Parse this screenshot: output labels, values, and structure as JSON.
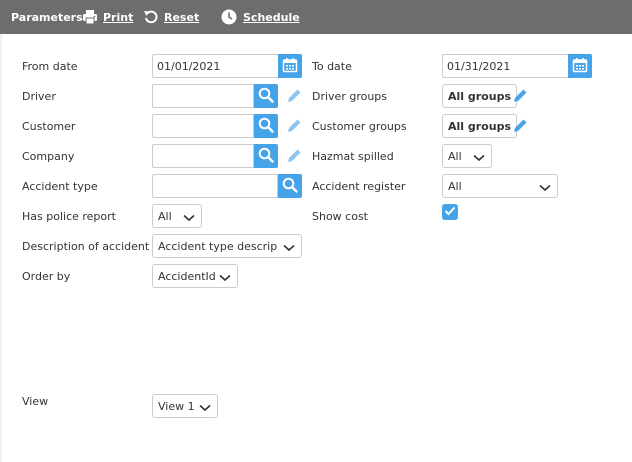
{
  "toolbar": {
    "title": "Parameters",
    "print_label": "Print",
    "reset_label": "Reset",
    "schedule_label": "Schedule"
  },
  "fields": {
    "from_date": {
      "label": "From date",
      "value": "01/01/2021"
    },
    "to_date": {
      "label": "To date",
      "value": "01/31/2021"
    },
    "driver": {
      "label": "Driver",
      "value": ""
    },
    "driver_groups": {
      "label": "Driver groups",
      "value": "All groups"
    },
    "customer": {
      "label": "Customer",
      "value": ""
    },
    "customer_groups": {
      "label": "Customer groups",
      "value": "All groups"
    },
    "company": {
      "label": "Company",
      "value": ""
    },
    "hazmat_spilled": {
      "label": "Hazmat spilled",
      "value": "All"
    },
    "accident_type": {
      "label": "Accident type",
      "value": ""
    },
    "accident_register": {
      "label": "Accident register",
      "value": "All"
    },
    "has_police_report": {
      "label": "Has police report",
      "value": "All"
    },
    "show_cost": {
      "label": "Show cost",
      "checked": true
    },
    "description_of_accident": {
      "label": "Description of accident",
      "value": "Accident type descriptic"
    },
    "order_by": {
      "label": "Order by",
      "value": "AccidentId"
    },
    "view": {
      "label": "View",
      "value": "View 1"
    }
  },
  "colors": {
    "toolbar_bg": "#6d6d6d",
    "accent": "#45a3e9",
    "pencil": "#8cc5f1"
  }
}
